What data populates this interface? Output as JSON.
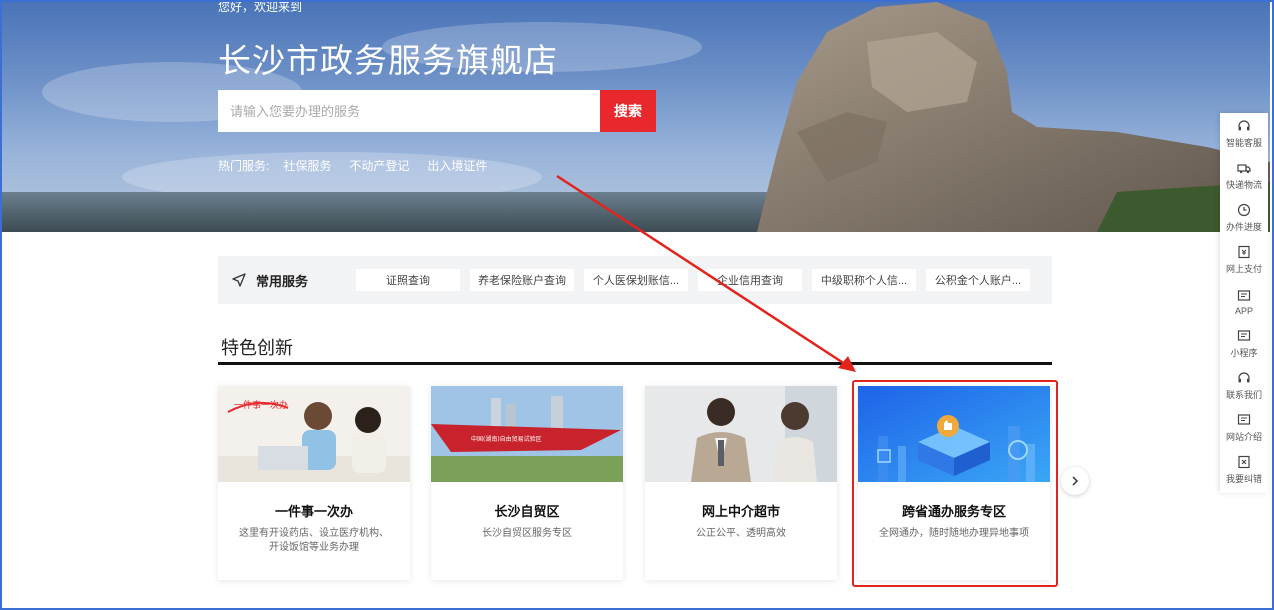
{
  "header": {
    "welcome": "您好，欢迎来到",
    "site_title": "长沙市政务服务旗舰店",
    "search_placeholder": "请输入您要办理的服务",
    "search_button": "搜索",
    "hot_label": "热门服务:",
    "hot_items": [
      "社保服务",
      "不动产登记",
      "出入境证件"
    ]
  },
  "common_services": {
    "title": "常用服务",
    "items": [
      "证照查询",
      "养老保险账户查询",
      "个人医保划账信...",
      "企业信用查询",
      "中级职称个人信...",
      "公积金个人账户..."
    ]
  },
  "featured": {
    "title": "特色创新",
    "cards": [
      {
        "name": "一件事一次办",
        "desc": "这里有开设药店、设立医疗机构、开设饭馆等业务办理",
        "badge": "一件事一次办"
      },
      {
        "name": "长沙自贸区",
        "desc": "长沙自贸区服务专区",
        "badge": "中国(湖南)自由贸易试验区"
      },
      {
        "name": "网上中介超市",
        "desc": "公正公平、透明高效"
      },
      {
        "name": "跨省通办服务专区",
        "desc": "全网通办，随时随地办理异地事项"
      }
    ]
  },
  "toolbar": {
    "items": [
      {
        "label": "智能客服",
        "icon": "headset-icon"
      },
      {
        "label": "快递物流",
        "icon": "truck-icon"
      },
      {
        "label": "办件进度",
        "icon": "clock-icon"
      },
      {
        "label": "网上支付",
        "icon": "payment-icon"
      },
      {
        "label": "APP",
        "icon": "app-icon"
      },
      {
        "label": "小程序",
        "icon": "miniprogram-icon"
      },
      {
        "label": "联系我们",
        "icon": "contact-icon"
      },
      {
        "label": "网站介绍",
        "icon": "info-icon"
      },
      {
        "label": "我要纠错",
        "icon": "report-icon"
      }
    ]
  },
  "colors": {
    "accent_red": "#e8282d",
    "highlight_red": "#e3241c",
    "frame_blue": "#3b6fd3"
  }
}
